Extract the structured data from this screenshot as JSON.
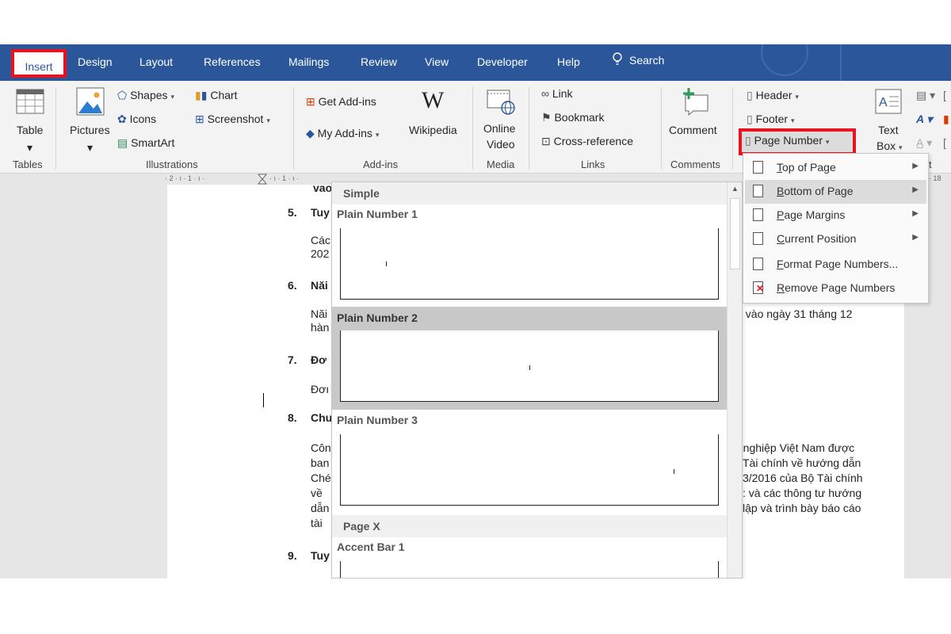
{
  "tabs": [
    "Insert",
    "Design",
    "Layout",
    "References",
    "Mailings",
    "Review",
    "View",
    "Developer",
    "Help"
  ],
  "search_label": "Search",
  "ribbon": {
    "tables": {
      "table": "Table",
      "group": "Tables"
    },
    "illustrations": {
      "pictures": "Pictures",
      "shapes": "Shapes",
      "icons": "Icons",
      "smartart": "SmartArt",
      "chart": "Chart",
      "screenshot": "Screenshot",
      "group": "Illustrations"
    },
    "addins": {
      "get": "Get Add-ins",
      "my": "My Add-ins",
      "wikipedia": "Wikipedia",
      "group": "Add-ins"
    },
    "media": {
      "online_video_1": "Online",
      "online_video_2": "Video",
      "group": "Media"
    },
    "links": {
      "link": "Link",
      "bookmark": "Bookmark",
      "crossref": "Cross-reference",
      "group": "Links"
    },
    "comments": {
      "comment": "Comment",
      "group": "Comments"
    },
    "header_footer": {
      "header": "Header",
      "footer": "Footer",
      "page_number": "Page Number"
    },
    "text": {
      "textbox_1": "Text",
      "textbox_2": "Box",
      "partial_label": "t"
    }
  },
  "ruler": {
    "left_text": "· 2 · ı · 1 · ı ·",
    "mid_text": "· ı · 1 · ı ·",
    "right_text": "· 18"
  },
  "document": {
    "frag_top": "vaơ",
    "items": [
      {
        "num": "5.",
        "head": "Tuy",
        "lines": [
          "Các",
          "202"
        ]
      },
      {
        "num": "6.",
        "head": "Năi",
        "lines": [
          "Năi",
          "hàn"
        ]
      },
      {
        "num": "7.",
        "head": "Đơ",
        "lines": [
          "Đơı"
        ]
      },
      {
        "num": "8.",
        "head": "Chu",
        "lines": [
          "Côn",
          "ban",
          "Ché",
          "về",
          "dẫn",
          "tài"
        ]
      },
      {
        "num": "9.",
        "head": "Tuy",
        "lines": []
      }
    ],
    "right_fragments": [
      "ıc vào ngày 31 tháng 12",
      "h nghiệp Việt Nam được",
      "Tài chính về hướng dẫn",
      "3/2016 của Bộ Tài chính",
      ": và các thông tư hướng",
      "lập và trình bày báo cáo"
    ]
  },
  "gallery": {
    "section_simple": "Simple",
    "section_page_x": "Page X",
    "items": [
      "Plain Number 1",
      "Plain Number 2",
      "Plain Number 3",
      "Accent Bar 1"
    ]
  },
  "menu": {
    "items": [
      {
        "pre": "",
        "ul": "T",
        "post": "op of Page",
        "arrow": true
      },
      {
        "pre": "",
        "ul": "B",
        "post": "ottom of Page",
        "arrow": true
      },
      {
        "pre": "",
        "ul": "P",
        "post": "age Margins",
        "arrow": true
      },
      {
        "pre": "",
        "ul": "C",
        "post": "urrent Position",
        "arrow": true
      },
      {
        "pre": "",
        "ul": "F",
        "post": "ormat Page Numbers...",
        "arrow": false
      },
      {
        "pre": "",
        "ul": "R",
        "post": "emove Page Numbers",
        "arrow": false
      }
    ]
  },
  "colors": {
    "accent": "#2b579a",
    "highlight_box": "#e8131e"
  }
}
